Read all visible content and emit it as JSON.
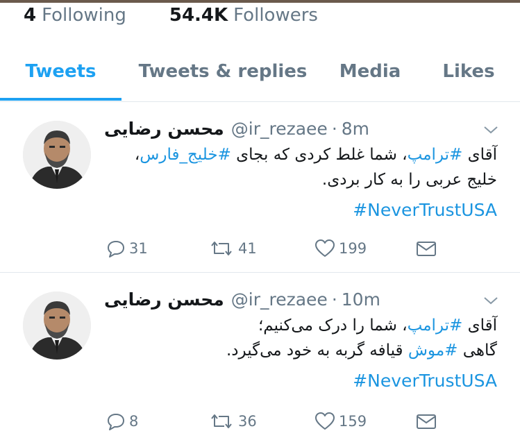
{
  "profile": {
    "following_count": "4",
    "following_label": "Following",
    "followers_count": "54.4K",
    "followers_label": "Followers"
  },
  "tabs": [
    {
      "label": "Tweets",
      "active": true
    },
    {
      "label": "Tweets & replies",
      "active": false
    },
    {
      "label": "Media",
      "active": false
    },
    {
      "label": "Likes",
      "active": false
    }
  ],
  "tweets": [
    {
      "author_name": "محسن رضایی",
      "handle": "@ir_rezaee",
      "separator": "·",
      "time": "8m",
      "text_lines": [
        [
          "آقای ",
          "#ترامپ",
          "، شما غلط کردی که بجای ",
          "#خلیج_فارس",
          "،"
        ],
        [
          "خلیج عربی را به کار بردی."
        ]
      ],
      "hashtag": "#NeverTrustUSA",
      "replies": "31",
      "retweets": "41",
      "likes": "199"
    },
    {
      "author_name": "محسن رضایی",
      "handle": "@ir_rezaee",
      "separator": "·",
      "time": "10m",
      "text_lines": [
        [
          "آقای ",
          "#ترامپ",
          "، شما را درک می‌کنیم؛"
        ],
        [
          "گاهی ",
          "#موش",
          " قیافه گربه به خود می‌گیرد."
        ]
      ],
      "hashtag": "#NeverTrustUSA",
      "replies": "8",
      "retweets": "36",
      "likes": "159"
    }
  ],
  "icons": {
    "reply": "reply-icon",
    "retweet": "retweet-icon",
    "like": "heart-icon",
    "dm": "envelope-icon",
    "menu": "chevron-down-icon"
  },
  "colors": {
    "accent": "#1da1f2",
    "link": "#1b95e0",
    "muted": "#657786",
    "text": "#14171a",
    "divider": "#e1e8ed"
  }
}
